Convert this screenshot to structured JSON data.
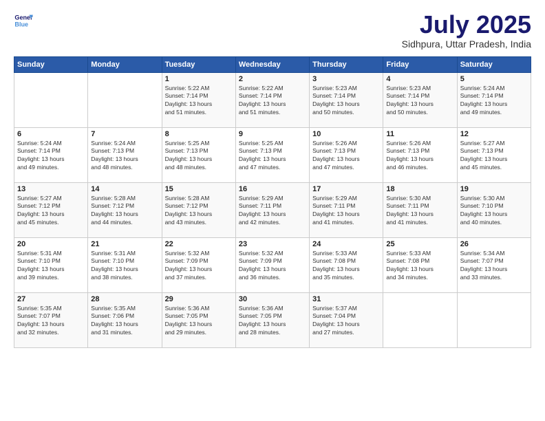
{
  "header": {
    "logo_line1": "General",
    "logo_line2": "Blue",
    "title": "July 2025",
    "subtitle": "Sidhpura, Uttar Pradesh, India"
  },
  "columns": [
    "Sunday",
    "Monday",
    "Tuesday",
    "Wednesday",
    "Thursday",
    "Friday",
    "Saturday"
  ],
  "weeks": [
    [
      {
        "day": "",
        "info": ""
      },
      {
        "day": "",
        "info": ""
      },
      {
        "day": "1",
        "info": "Sunrise: 5:22 AM\nSunset: 7:14 PM\nDaylight: 13 hours\nand 51 minutes."
      },
      {
        "day": "2",
        "info": "Sunrise: 5:22 AM\nSunset: 7:14 PM\nDaylight: 13 hours\nand 51 minutes."
      },
      {
        "day": "3",
        "info": "Sunrise: 5:23 AM\nSunset: 7:14 PM\nDaylight: 13 hours\nand 50 minutes."
      },
      {
        "day": "4",
        "info": "Sunrise: 5:23 AM\nSunset: 7:14 PM\nDaylight: 13 hours\nand 50 minutes."
      },
      {
        "day": "5",
        "info": "Sunrise: 5:24 AM\nSunset: 7:14 PM\nDaylight: 13 hours\nand 49 minutes."
      }
    ],
    [
      {
        "day": "6",
        "info": "Sunrise: 5:24 AM\nSunset: 7:14 PM\nDaylight: 13 hours\nand 49 minutes."
      },
      {
        "day": "7",
        "info": "Sunrise: 5:24 AM\nSunset: 7:13 PM\nDaylight: 13 hours\nand 48 minutes."
      },
      {
        "day": "8",
        "info": "Sunrise: 5:25 AM\nSunset: 7:13 PM\nDaylight: 13 hours\nand 48 minutes."
      },
      {
        "day": "9",
        "info": "Sunrise: 5:25 AM\nSunset: 7:13 PM\nDaylight: 13 hours\nand 47 minutes."
      },
      {
        "day": "10",
        "info": "Sunrise: 5:26 AM\nSunset: 7:13 PM\nDaylight: 13 hours\nand 47 minutes."
      },
      {
        "day": "11",
        "info": "Sunrise: 5:26 AM\nSunset: 7:13 PM\nDaylight: 13 hours\nand 46 minutes."
      },
      {
        "day": "12",
        "info": "Sunrise: 5:27 AM\nSunset: 7:13 PM\nDaylight: 13 hours\nand 45 minutes."
      }
    ],
    [
      {
        "day": "13",
        "info": "Sunrise: 5:27 AM\nSunset: 7:12 PM\nDaylight: 13 hours\nand 45 minutes."
      },
      {
        "day": "14",
        "info": "Sunrise: 5:28 AM\nSunset: 7:12 PM\nDaylight: 13 hours\nand 44 minutes."
      },
      {
        "day": "15",
        "info": "Sunrise: 5:28 AM\nSunset: 7:12 PM\nDaylight: 13 hours\nand 43 minutes."
      },
      {
        "day": "16",
        "info": "Sunrise: 5:29 AM\nSunset: 7:11 PM\nDaylight: 13 hours\nand 42 minutes."
      },
      {
        "day": "17",
        "info": "Sunrise: 5:29 AM\nSunset: 7:11 PM\nDaylight: 13 hours\nand 41 minutes."
      },
      {
        "day": "18",
        "info": "Sunrise: 5:30 AM\nSunset: 7:11 PM\nDaylight: 13 hours\nand 41 minutes."
      },
      {
        "day": "19",
        "info": "Sunrise: 5:30 AM\nSunset: 7:10 PM\nDaylight: 13 hours\nand 40 minutes."
      }
    ],
    [
      {
        "day": "20",
        "info": "Sunrise: 5:31 AM\nSunset: 7:10 PM\nDaylight: 13 hours\nand 39 minutes."
      },
      {
        "day": "21",
        "info": "Sunrise: 5:31 AM\nSunset: 7:10 PM\nDaylight: 13 hours\nand 38 minutes."
      },
      {
        "day": "22",
        "info": "Sunrise: 5:32 AM\nSunset: 7:09 PM\nDaylight: 13 hours\nand 37 minutes."
      },
      {
        "day": "23",
        "info": "Sunrise: 5:32 AM\nSunset: 7:09 PM\nDaylight: 13 hours\nand 36 minutes."
      },
      {
        "day": "24",
        "info": "Sunrise: 5:33 AM\nSunset: 7:08 PM\nDaylight: 13 hours\nand 35 minutes."
      },
      {
        "day": "25",
        "info": "Sunrise: 5:33 AM\nSunset: 7:08 PM\nDaylight: 13 hours\nand 34 minutes."
      },
      {
        "day": "26",
        "info": "Sunrise: 5:34 AM\nSunset: 7:07 PM\nDaylight: 13 hours\nand 33 minutes."
      }
    ],
    [
      {
        "day": "27",
        "info": "Sunrise: 5:35 AM\nSunset: 7:07 PM\nDaylight: 13 hours\nand 32 minutes."
      },
      {
        "day": "28",
        "info": "Sunrise: 5:35 AM\nSunset: 7:06 PM\nDaylight: 13 hours\nand 31 minutes."
      },
      {
        "day": "29",
        "info": "Sunrise: 5:36 AM\nSunset: 7:05 PM\nDaylight: 13 hours\nand 29 minutes."
      },
      {
        "day": "30",
        "info": "Sunrise: 5:36 AM\nSunset: 7:05 PM\nDaylight: 13 hours\nand 28 minutes."
      },
      {
        "day": "31",
        "info": "Sunrise: 5:37 AM\nSunset: 7:04 PM\nDaylight: 13 hours\nand 27 minutes."
      },
      {
        "day": "",
        "info": ""
      },
      {
        "day": "",
        "info": ""
      }
    ]
  ]
}
